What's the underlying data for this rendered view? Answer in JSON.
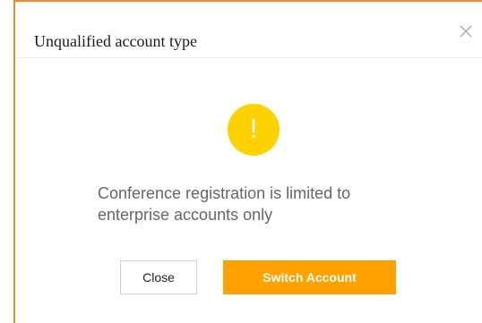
{
  "dialog": {
    "title": "Unqualified account type",
    "close_icon": "close-icon",
    "warning_icon": "exclamation-circle-icon",
    "warning_glyph": "!",
    "message": "Conference registration is limited to enterprise accounts only",
    "buttons": {
      "close_label": "Close",
      "switch_label": "Switch Account"
    }
  },
  "colors": {
    "frame_accent": "#f08a2c",
    "warning": "#fcd200",
    "primary_button": "#ffa100"
  }
}
